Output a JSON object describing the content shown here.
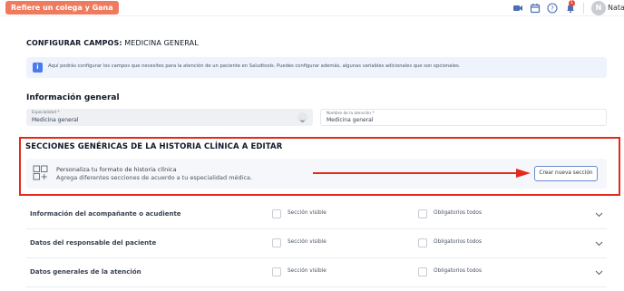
{
  "topbar": {
    "refer_button": "Refiere un colega y Gana",
    "notification_count": "1",
    "user_initial": "N",
    "user_name": "Nata"
  },
  "config": {
    "title_prefix": "CONFIGURAR CAMPOS:",
    "title_value": "MEDICINA GENERAL",
    "info_text": "Aquí podrás configurar los campos que necesites para la atención de un paciente en Saludtools. Puedes configurar además, algunas variables adicionales que son opcionales."
  },
  "general_info": {
    "heading": "Información general",
    "specialty_label": "Especialidad *",
    "specialty_value": "Medicina general",
    "attention_name_label": "Nombre de la atención *",
    "attention_name_value": "Medicina general"
  },
  "sections": {
    "heading": "SECCIONES GENÉRICAS DE LA HISTORIA CLÍNICA A EDITAR",
    "card_title": "Personaliza tu formato de historia clínica",
    "card_subtitle": "Agrega diferentes secciones de acuerdo a tu especialidad médica.",
    "new_section_button": "Crear nueva sección"
  },
  "rows": [
    {
      "title": "Información del acompañante o acudiente",
      "visible_label": "Sección visible",
      "required_label": "Obligatorios todos"
    },
    {
      "title": "Datos del responsable del paciente",
      "visible_label": "Sección visible",
      "required_label": "Obligatorios todos"
    },
    {
      "title": "Datos generales de la atención",
      "visible_label": "Sección visible",
      "required_label": "Obligatorios todos"
    }
  ],
  "colors": {
    "accent_orange": "#ef7b5f",
    "highlight_red": "#e22b1c",
    "info_blue": "#4b7bec"
  }
}
